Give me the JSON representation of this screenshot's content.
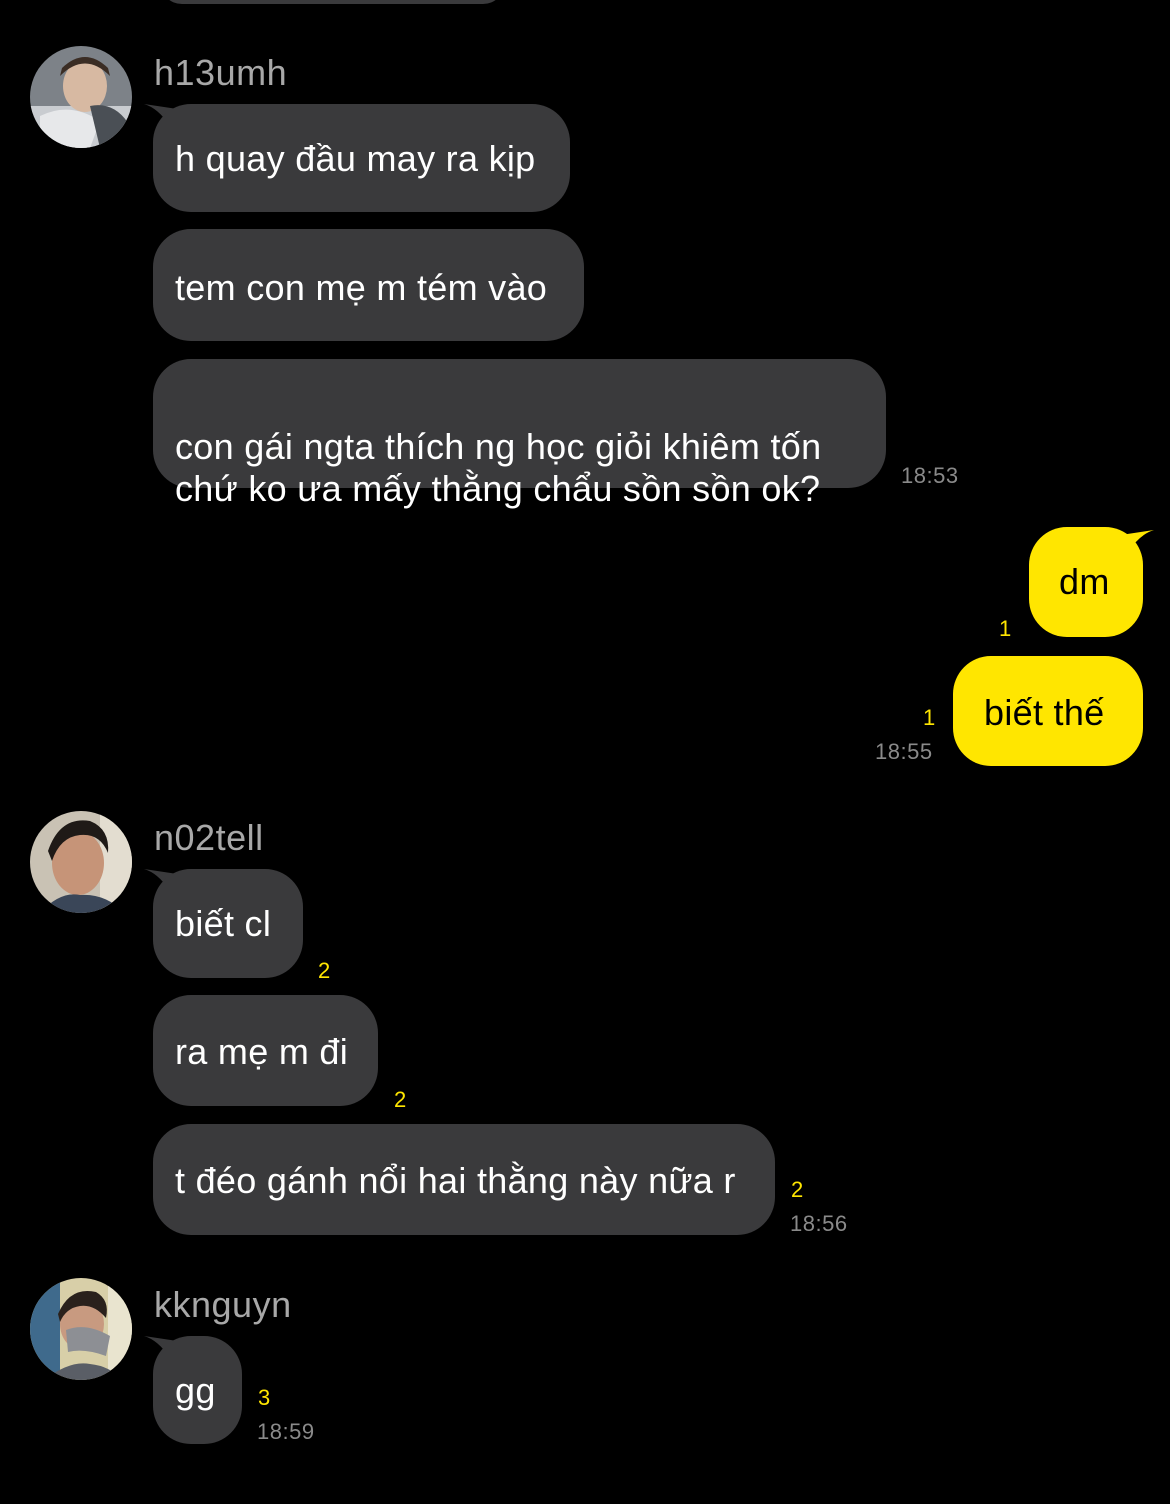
{
  "groups": [
    {
      "sender": "h13umh",
      "avatar_icon": "user-avatar-icon",
      "messages": [
        {
          "text": "h quay đầu may ra kịp"
        },
        {
          "text": "tem con mẹ m tém vào"
        },
        {
          "text": "con gái ngta thích ng học giỏi khiêm tốn\nchứ ko ưa mấy thằng chẩu sồn sồn ok?"
        }
      ],
      "time": "18:53"
    },
    {
      "sender": "me",
      "messages": [
        {
          "text": "dm",
          "unread": "1"
        },
        {
          "text": "biết thế",
          "unread": "1"
        }
      ],
      "time": "18:55"
    },
    {
      "sender": "n02tell",
      "avatar_icon": "user-avatar-icon",
      "messages": [
        {
          "text": "biết cl",
          "unread": "2"
        },
        {
          "text": "ra mẹ m đi",
          "unread": "2"
        },
        {
          "text": "t đéo gánh nổi hai thằng này nữa r",
          "unread": "2"
        }
      ],
      "time": "18:56"
    },
    {
      "sender": "kknguyn",
      "avatar_icon": "user-avatar-icon",
      "messages": [
        {
          "text": "gg",
          "unread": "3"
        }
      ],
      "time": "18:59"
    }
  ],
  "colors": {
    "background": "#000000",
    "incoming_bubble": "#3a3a3c",
    "outgoing_bubble": "#ffe600",
    "unread_count": "#ffe600",
    "timestamp": "#8a8a8a",
    "sender_name": "#a8a8a8"
  }
}
